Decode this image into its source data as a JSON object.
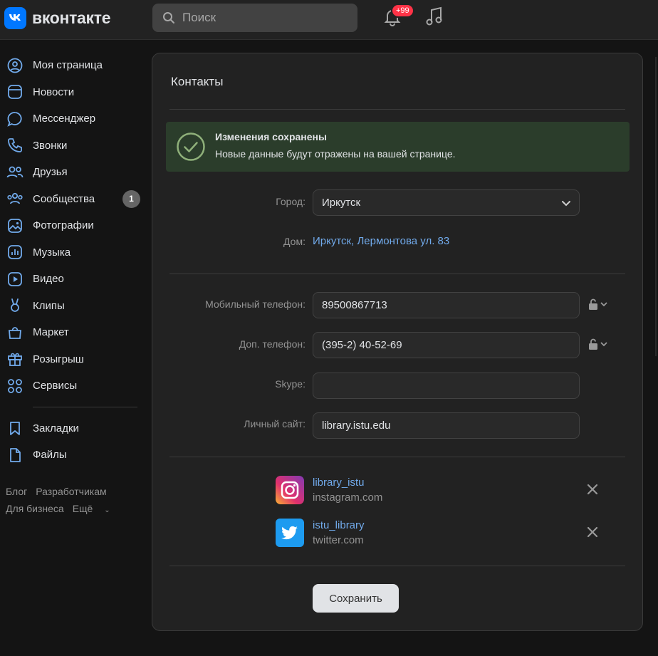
{
  "header": {
    "logo_text": "вконтакте",
    "search_placeholder": "Поиск",
    "notifications_badge": "+99"
  },
  "sidebar": {
    "items": [
      {
        "label": "Моя страница",
        "icon": "user-circle-icon"
      },
      {
        "label": "Новости",
        "icon": "news-icon"
      },
      {
        "label": "Мессенджер",
        "icon": "message-icon"
      },
      {
        "label": "Звонки",
        "icon": "phone-icon"
      },
      {
        "label": "Друзья",
        "icon": "friends-icon"
      },
      {
        "label": "Сообщества",
        "icon": "communities-icon",
        "count": "1"
      },
      {
        "label": "Фотографии",
        "icon": "photo-icon"
      },
      {
        "label": "Музыка",
        "icon": "music-icon"
      },
      {
        "label": "Видео",
        "icon": "video-icon"
      },
      {
        "label": "Клипы",
        "icon": "clips-icon"
      },
      {
        "label": "Маркет",
        "icon": "market-icon"
      },
      {
        "label": "Розыгрыш",
        "icon": "gift-icon"
      },
      {
        "label": "Сервисы",
        "icon": "services-icon"
      }
    ],
    "items2": [
      {
        "label": "Закладки",
        "icon": "bookmark-icon"
      },
      {
        "label": "Файлы",
        "icon": "file-icon"
      }
    ],
    "footer": {
      "blog": "Блог",
      "dev": "Разработчикам",
      "business": "Для бизнеса",
      "more": "Ещё"
    }
  },
  "card": {
    "title": "Контакты",
    "success_title": "Изменения сохранены",
    "success_text": "Новые данные будут отражены на вашей странице.",
    "city_label": "Город:",
    "city_value": "Иркутск",
    "home_label": "Дом:",
    "home_value": "Иркутск, Лермонтова ул. 83",
    "mobile_label": "Мобильный телефон:",
    "mobile_value": "89500867713",
    "extra_label": "Доп. телефон:",
    "extra_value": "(395-2) 40-52-69",
    "skype_label": "Skype:",
    "skype_value": "",
    "site_label": "Личный сайт:",
    "site_value": "library.istu.edu",
    "social": [
      {
        "name": "library_istu",
        "domain": "instagram.com"
      },
      {
        "name": "istu_library",
        "domain": "twitter.com"
      }
    ],
    "save_label": "Сохранить"
  },
  "colors": {
    "accent": "#0077ff",
    "link": "#71aaeb",
    "success_bg": "#2b3d2b",
    "badge": "#ff3347"
  }
}
